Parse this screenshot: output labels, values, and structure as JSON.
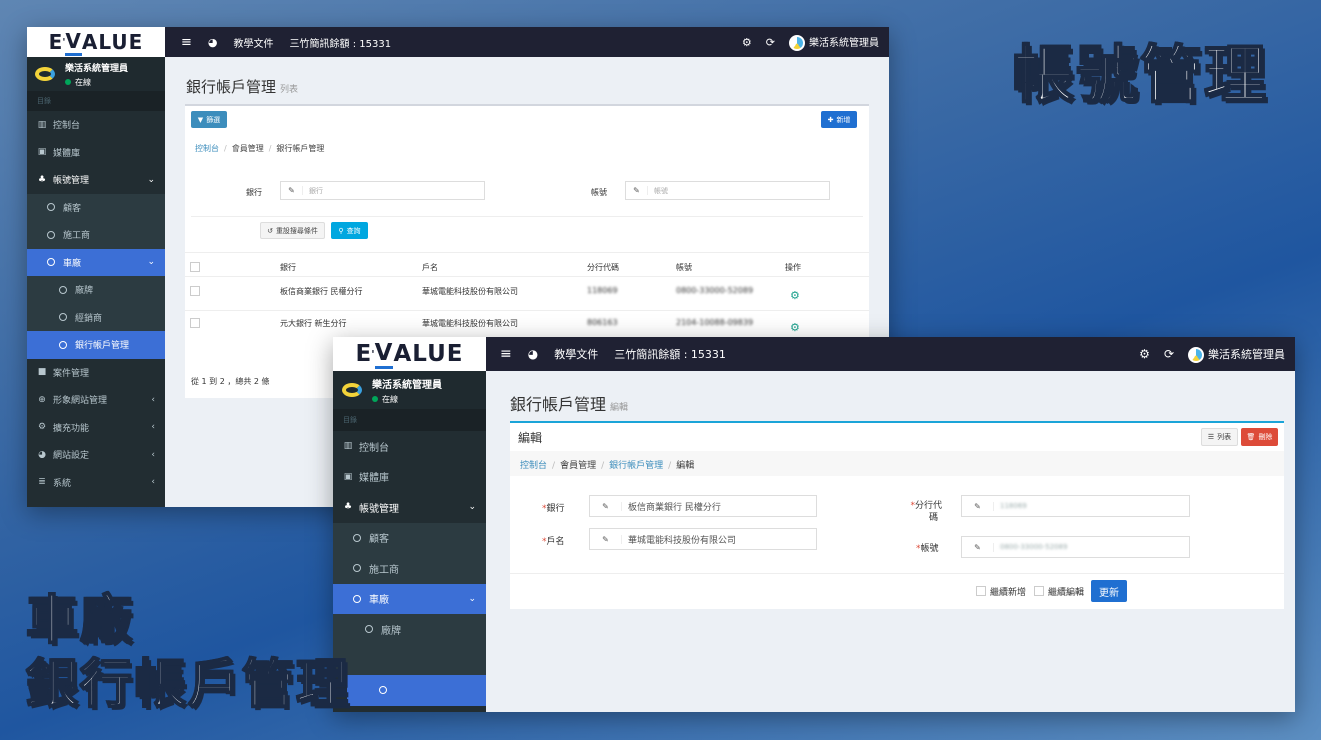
{
  "overlay": {
    "title_account": "帳號管理",
    "title_car": "車廠",
    "title_bank": "銀行帳戶管理"
  },
  "topbar": {
    "logo_e": "E",
    "logo_v": "V",
    "logo_rest": "ALUE",
    "menu_icon": "≡",
    "globe_icon": "◕",
    "docs": "教學文件",
    "sms": "三竹簡訊餘額 : 15331",
    "user": "樂活系統管理員"
  },
  "sidebar": {
    "user_name": "樂活系統管理員",
    "status": "在線",
    "header": "目錄",
    "items": {
      "dashboard": "控制台",
      "media": "媒體庫",
      "accounts": "帳號管理",
      "customer": "顧客",
      "contractor": "施工商",
      "carmaker": "車廠",
      "factory": "廠牌",
      "dealer": "經銷商",
      "bank": "銀行帳戶管理",
      "cases": "案件管理",
      "site": "形象網站管理",
      "extend": "擴充功能",
      "settings": "網站設定",
      "system": "系統"
    }
  },
  "list_page": {
    "title": "銀行帳戶管理",
    "subtitle": "列表",
    "filter_btn": "篩選",
    "add_btn": "新增",
    "breadcrumb": [
      "控制台",
      "會員管理",
      "銀行帳戶管理"
    ],
    "bank_label": "銀行",
    "bank_placeholder": "銀行",
    "account_label": "帳號",
    "account_placeholder": "帳號",
    "reset_btn": "重設搜尋條件",
    "search_btn": "查詢",
    "columns": [
      "銀行",
      "戶名",
      "分行代碼",
      "帳號",
      "操作"
    ],
    "rows": [
      {
        "bank": "板信商業銀行 民權分行",
        "holder": "華城電能科技股份有限公司",
        "code": "118069",
        "account": "0800-33000-52089"
      },
      {
        "bank": "元大銀行 新生分行",
        "holder": "華城電能科技股份有限公司",
        "code": "806163",
        "account": "2104-10088-09839"
      }
    ],
    "footer": "從 1 到 2 ，總共 2 條"
  },
  "edit_page": {
    "title": "銀行帳戶管理",
    "subtitle": "編輯",
    "box_title": "編輯",
    "list_btn": "列表",
    "delete_btn": "刪除",
    "breadcrumb": [
      "控制台",
      "會員管理",
      "銀行帳戶管理",
      "編輯"
    ],
    "bank_label": "銀行",
    "bank_value": "板信商業銀行 民權分行",
    "holder_label": "戶名",
    "holder_value": "華城電能科技股份有限公司",
    "branch_label_1": "分行代",
    "branch_label_2": "碼",
    "branch_value": "118069",
    "account_label": "帳號",
    "account_value": "0800-33000-52089",
    "continue_add": "繼續新增",
    "continue_edit": "繼續編輯",
    "update_btn": "更新",
    "required_mark": "*"
  }
}
